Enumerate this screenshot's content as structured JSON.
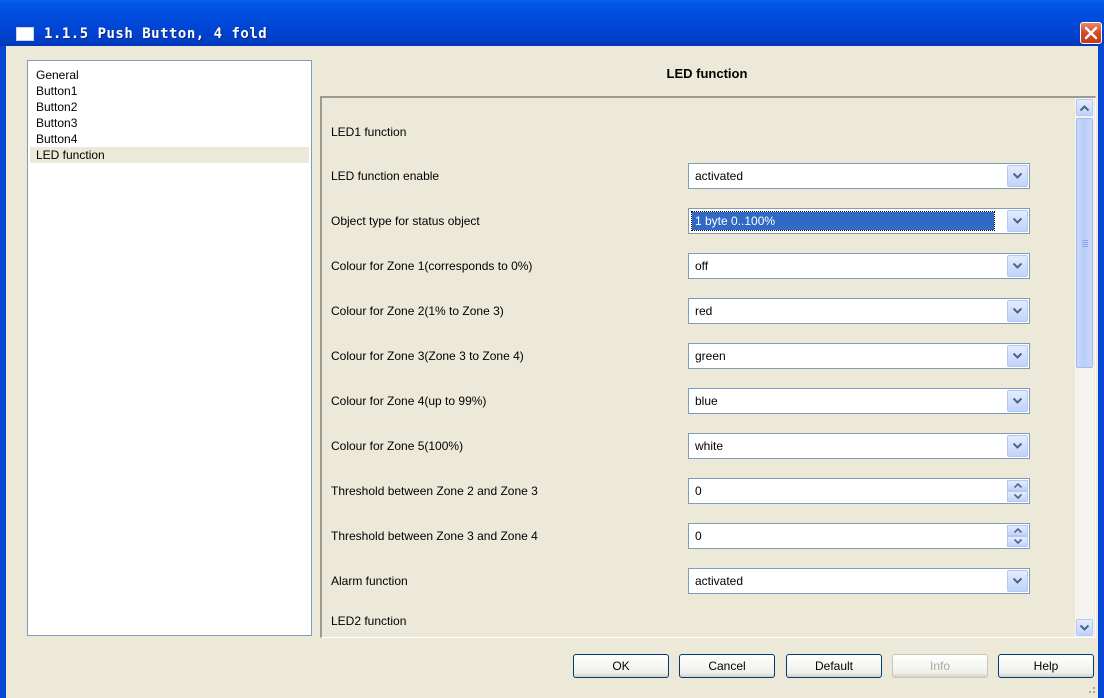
{
  "window": {
    "title": "1.1.5 Push Button, 4 fold"
  },
  "tree": {
    "items": [
      {
        "label": "General"
      },
      {
        "label": "Button1"
      },
      {
        "label": "Button2"
      },
      {
        "label": "Button3"
      },
      {
        "label": "Button4"
      },
      {
        "label": "LED function",
        "selected": true
      }
    ]
  },
  "panel": {
    "title": "LED function",
    "rows": [
      {
        "label": "LED1 function",
        "kind": "section"
      },
      {
        "label": "LED function enable",
        "kind": "select",
        "value": "activated"
      },
      {
        "label": "Object type for status object",
        "kind": "select",
        "value": "1 byte 0..100%",
        "focused": true
      },
      {
        "label": "Colour for Zone 1(corresponds to 0%)",
        "kind": "select",
        "value": "off"
      },
      {
        "label": "Colour for Zone 2(1% to Zone 3)",
        "kind": "select",
        "value": "red"
      },
      {
        "label": "Colour for Zone 3(Zone 3 to Zone 4)",
        "kind": "select",
        "value": "green"
      },
      {
        "label": "Colour for Zone 4(up to 99%)",
        "kind": "select",
        "value": "blue"
      },
      {
        "label": "Colour for Zone 5(100%)",
        "kind": "select",
        "value": "white"
      },
      {
        "label": "Threshold between Zone 2 and Zone 3",
        "kind": "spin",
        "value": "0"
      },
      {
        "label": "Threshold between Zone 3 and Zone 4",
        "kind": "spin",
        "value": "0"
      },
      {
        "label": "Alarm function",
        "kind": "select",
        "value": "activated"
      },
      {
        "label": "LED2 function",
        "kind": "section"
      }
    ]
  },
  "buttons": {
    "ok": "OK",
    "cancel": "Cancel",
    "default": "Default",
    "info": "Info",
    "help": "Help"
  },
  "icons": {
    "close": "close-icon",
    "dropdown": "chevron-down-icon",
    "spin_up": "spin-up-icon",
    "spin_down": "spin-down-icon",
    "scroll_up": "scroll-up-icon",
    "scroll_down": "scroll-down-icon"
  },
  "colors": {
    "titlebar": "#0055e5",
    "selection": "#316ac5",
    "window_bg": "#ece9d8"
  }
}
